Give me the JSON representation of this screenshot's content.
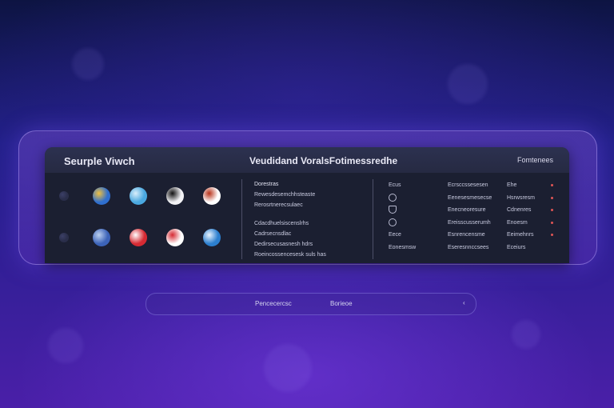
{
  "window": {
    "app_title": "Seurple Viwch",
    "center_title": "Veudidand VoralsFotimessredhe",
    "right_title": "Fomtenees"
  },
  "icons": [
    {
      "name": "dark-dot-icon",
      "bg": "#2a2e4a",
      "accent": "#3b3f66"
    },
    {
      "name": "globe-app-icon",
      "bg": "#2f6fcf",
      "accent": "#f0c040"
    },
    {
      "name": "image-viewer-icon",
      "bg": "#4aa8e0",
      "accent": "#d8eefa"
    },
    {
      "name": "moon-app-icon",
      "bg": "#f2f2f5",
      "accent": "#111111"
    },
    {
      "name": "media-app-icon",
      "bg": "#ffffff",
      "accent": "#b8321a"
    },
    {
      "name": "dark-dot-icon-2",
      "bg": "#2a2e4a",
      "accent": "#3b3f66"
    },
    {
      "name": "puzzle-app-icon",
      "bg": "#3c63b8",
      "accent": "#bcd0ef"
    },
    {
      "name": "red-app-icon",
      "bg": "#d62a33",
      "accent": "#ffffff"
    },
    {
      "name": "split-app-icon",
      "bg": "#ffffff",
      "accent": "#d62a33"
    },
    {
      "name": "search-app-icon",
      "bg": "#2c7fcf",
      "accent": "#eaf4ff"
    }
  ],
  "middle_list": [
    "Dorestras",
    "Rewesdesemchhsteaste",
    "Rerosrtnerecsulaec",
    "Cdacdhuelsiscenslrhs",
    "Cadrsecnsdlac",
    "Dedirsecusasnesh hdrs",
    "Roeincossencesesk suls has"
  ],
  "right_rows": [
    {
      "c1": "Ecus",
      "c2": "Ecrsccssesesen",
      "c3": "Ehe"
    },
    {
      "c1": "",
      "c2": "Eenesesmesecse",
      "c3": "Hsrwsresm"
    },
    {
      "c1": "",
      "c2": "Enecneoresure",
      "c3": "Cdnenres"
    },
    {
      "c1": "",
      "c2": "Ereisscusserumh",
      "c3": "Enoesm"
    },
    {
      "c1": "Eece",
      "c2": "Esnrencensme",
      "c3": "Eeimehnrs"
    },
    {
      "c1": "Eonesmsw",
      "c2": "Eseresnnccsees",
      "c3": "Eceiurs"
    }
  ],
  "bottom_bar": {
    "label1": "Pencecercsc",
    "label2": "Borieoe",
    "chevron": "‹"
  }
}
